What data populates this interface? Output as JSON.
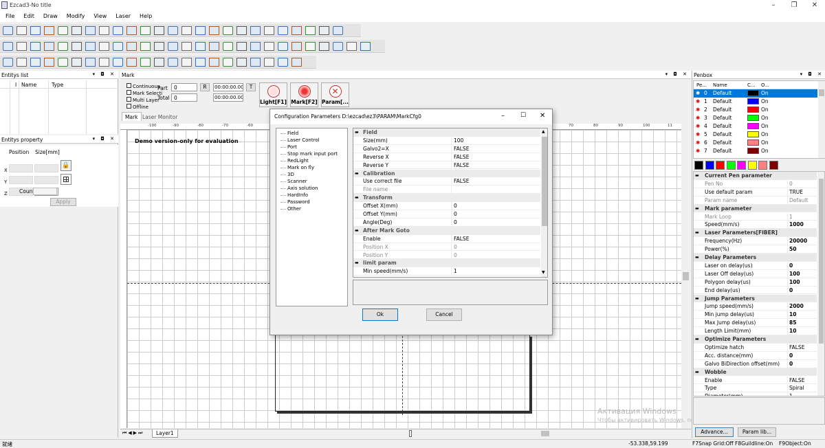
{
  "app": {
    "title": "Ezcad3-No title"
  },
  "menu": [
    "File",
    "Edit",
    "Draw",
    "Modify",
    "View",
    "Laser",
    "Help"
  ],
  "entity_list": {
    "title": "Entitys list",
    "cols": [
      "I",
      "Name",
      "Type"
    ]
  },
  "entity_prop": {
    "title": "Entitys property",
    "position": "Position",
    "size": "Size[mm]",
    "x": "X",
    "y": "Y",
    "z": "Z",
    "count": "Count",
    "apply": "Apply"
  },
  "mark_panel": {
    "title": "Mark",
    "continuous": "Continuous",
    "mark_selection": "Mark Selecti",
    "multi_layer": "Multi Layer",
    "offline": "Offline",
    "part": "Part",
    "part_val": "0",
    "total": "Total",
    "total_val": "0",
    "r": "R",
    "time1": "00:00:00.000",
    "time2": "00:00:00.000",
    "t": "T",
    "light": "Light[F1]",
    "mark": "Mark[F2]",
    "param": "Param[...",
    "tab_mark": "Mark",
    "tab_monitor": "Laser Monitor",
    "demo": "Demo version-only for evaluation",
    "ruler": [
      "-100",
      "-90",
      "-80",
      "-70",
      "-60",
      "-50",
      "-40",
      "-30",
      "-20",
      "-10",
      "0",
      "10",
      "20",
      "30",
      "40",
      "50",
      "60",
      "70",
      "80",
      "90",
      "100",
      "11"
    ],
    "layer_tab": "Layer1"
  },
  "dialog": {
    "title": "Configuration Parameters D:\\ezcad\\ez3\\PARAM\\MarkCfg0",
    "tree": [
      "Field",
      "Laser Control",
      "Port",
      "Stop mark input port",
      "RedLight",
      "Mark on fly",
      "3D",
      "Scanner",
      "Axis solution",
      "HardInfo",
      "Password",
      "Other"
    ],
    "rows": [
      {
        "t": "g",
        "n": "Field"
      },
      {
        "n": "Size(mm)",
        "v": "100"
      },
      {
        "n": "Galvo2=X",
        "v": "FALSE"
      },
      {
        "n": "Reverse X",
        "v": "FALSE"
      },
      {
        "n": "Reverse Y",
        "v": "FALSE"
      },
      {
        "t": "g",
        "n": "Calibration"
      },
      {
        "n": "Use correct file",
        "v": "FALSE"
      },
      {
        "n": "File name",
        "v": "",
        "d": 1
      },
      {
        "t": "g",
        "n": "Transform"
      },
      {
        "n": "Offset X(mm)",
        "v": "0"
      },
      {
        "n": "Offset Y(mm)",
        "v": "0"
      },
      {
        "n": "Angle(Deg)",
        "v": "0"
      },
      {
        "t": "g",
        "n": "After Mark Goto"
      },
      {
        "n": "Enable",
        "v": "FALSE"
      },
      {
        "n": "Position X",
        "v": "0",
        "d": 1
      },
      {
        "n": "Position Y",
        "v": "0",
        "d": 1
      },
      {
        "t": "g",
        "n": "limit param"
      },
      {
        "n": "Min speed(mm/s)",
        "v": "1"
      }
    ],
    "ok": "Ok",
    "cancel": "Cancel"
  },
  "penbox": {
    "title": "Penbox",
    "cols": [
      "Pe...",
      "Name",
      "C...",
      "O..."
    ],
    "pens": [
      {
        "no": "0",
        "name": "Default",
        "color": "#000000",
        "on": "On"
      },
      {
        "no": "1",
        "name": "Default",
        "color": "#0000ff",
        "on": "On"
      },
      {
        "no": "2",
        "name": "Default",
        "color": "#ff0000",
        "on": "On"
      },
      {
        "no": "3",
        "name": "Default",
        "color": "#00ff00",
        "on": "On"
      },
      {
        "no": "4",
        "name": "Default",
        "color": "#ff00ff",
        "on": "On"
      },
      {
        "no": "5",
        "name": "Default",
        "color": "#ffff00",
        "on": "On"
      },
      {
        "no": "6",
        "name": "Default",
        "color": "#ff8080",
        "on": "On"
      },
      {
        "no": "7",
        "name": "Default",
        "color": "#800000",
        "on": "On"
      }
    ],
    "palette": [
      "#000000",
      "#0000ff",
      "#ff0000",
      "#00ff00",
      "#ff00ff",
      "#ffff00",
      "#ff8080",
      "#800000"
    ],
    "props": [
      {
        "t": "g",
        "n": "Current Pen parameter"
      },
      {
        "n": "Pen No",
        "v": "0",
        "g": 1
      },
      {
        "n": "Use default param",
        "v": "TRUE"
      },
      {
        "n": "Param name",
        "v": "Default",
        "g": 1
      },
      {
        "t": "g",
        "n": "Mark parameter"
      },
      {
        "n": "Mark Loop",
        "v": "1",
        "g": 1
      },
      {
        "n": "Speed(mm/s)",
        "v": "1000",
        "b": 1
      },
      {
        "t": "g",
        "n": "Laser Parameters[FIBER]"
      },
      {
        "n": "Frequency(Hz)",
        "v": "20000",
        "b": 1
      },
      {
        "n": "Power(%)",
        "v": "50",
        "b": 1
      },
      {
        "t": "g",
        "n": "Delay Parameters"
      },
      {
        "n": "Laser on delay(us)",
        "v": "0",
        "b": 1
      },
      {
        "n": "Laser Off delay(us)",
        "v": "100",
        "b": 1
      },
      {
        "n": "Polygon delay(us)",
        "v": "100",
        "b": 1
      },
      {
        "n": "End delay(us)",
        "v": "0",
        "b": 1
      },
      {
        "t": "g",
        "n": "Jump Parameters"
      },
      {
        "n": "Jump speed(mm/s)",
        "v": "2000",
        "b": 1
      },
      {
        "n": "Min jump delay(us)",
        "v": "10",
        "b": 1
      },
      {
        "n": "Max Jump delay(us)",
        "v": "85",
        "b": 1
      },
      {
        "n": "Length Limit(mm)",
        "v": "10",
        "b": 1
      },
      {
        "t": "g",
        "n": "Optimize Parameters"
      },
      {
        "n": "Optimize hatch",
        "v": "FALSE"
      },
      {
        "n": "Acc. distance(mm)",
        "v": "0",
        "b": 1
      },
      {
        "n": "Galvo BiDirection offset(mm)",
        "v": "0",
        "b": 1
      },
      {
        "t": "g",
        "n": "Wobble"
      },
      {
        "n": "Enable",
        "v": "FALSE"
      },
      {
        "n": "Type",
        "v": "Spiral"
      },
      {
        "n": "Diameter(mm)",
        "v": "1"
      }
    ],
    "advance": "Advance...",
    "paramlib": "Param lib..."
  },
  "status": {
    "left": "就绪",
    "coords": "-53.338,59.199",
    "snap": "F7Snap Grid:Off",
    "guide": "F8Guildline:On",
    "object": "F9Object:On"
  },
  "watermark": {
    "line1": "Активация Windows",
    "line2": "Чтобы активировать Windows, перейдите в раздел \"Параметры\"."
  }
}
